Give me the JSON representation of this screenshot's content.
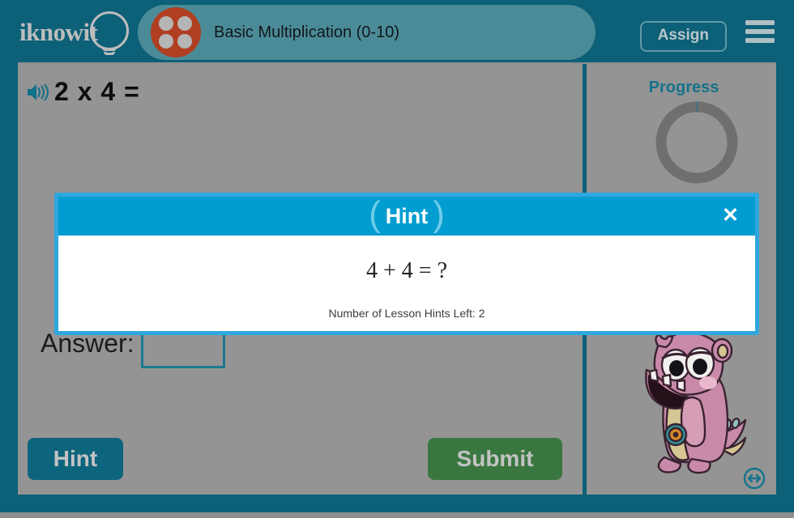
{
  "app": {
    "brand": "iknowit",
    "background_color": "#949494",
    "frame_color": "#0c6077"
  },
  "header": {
    "logo_text": "iknowit",
    "logo_icon": "lightbulb-icon",
    "subject_icon": "four-dots-circle-icon",
    "lesson_title": "Basic Multiplication (0-10)",
    "assign_label": "Assign",
    "menu_icon": "hamburger-menu-icon",
    "pill_color": "#4b8b98",
    "subject_icon_color": "#b03f22"
  },
  "question": {
    "audio_icon": "speaker-icon",
    "text": "2 x 4 ="
  },
  "progress": {
    "label": "Progress",
    "ring_color": "#6f6f6f",
    "accent_color": "#14728c"
  },
  "answer": {
    "label": "Answer:",
    "value": "",
    "placeholder": ""
  },
  "actions": {
    "hint_label": "Hint",
    "hint_color": "#0d657d",
    "submit_label": "Submit",
    "submit_color": "#3a7740"
  },
  "mascot": {
    "name": "pink-monster-mascot",
    "body_color": "#c88aa8",
    "belly_color": "#cfc08a"
  },
  "resize": {
    "icon": "resize-horizontal-icon"
  },
  "hint_modal": {
    "title": "Hint",
    "left_paren": "(",
    "right_paren": ")",
    "close_label": "✕",
    "equation": "4 + 4 = ?",
    "hints_left_text": "Number of Lesson Hints Left: 2",
    "hints_left_count": 2,
    "header_color": "#019dd0",
    "border_color": "#2fa7df"
  }
}
